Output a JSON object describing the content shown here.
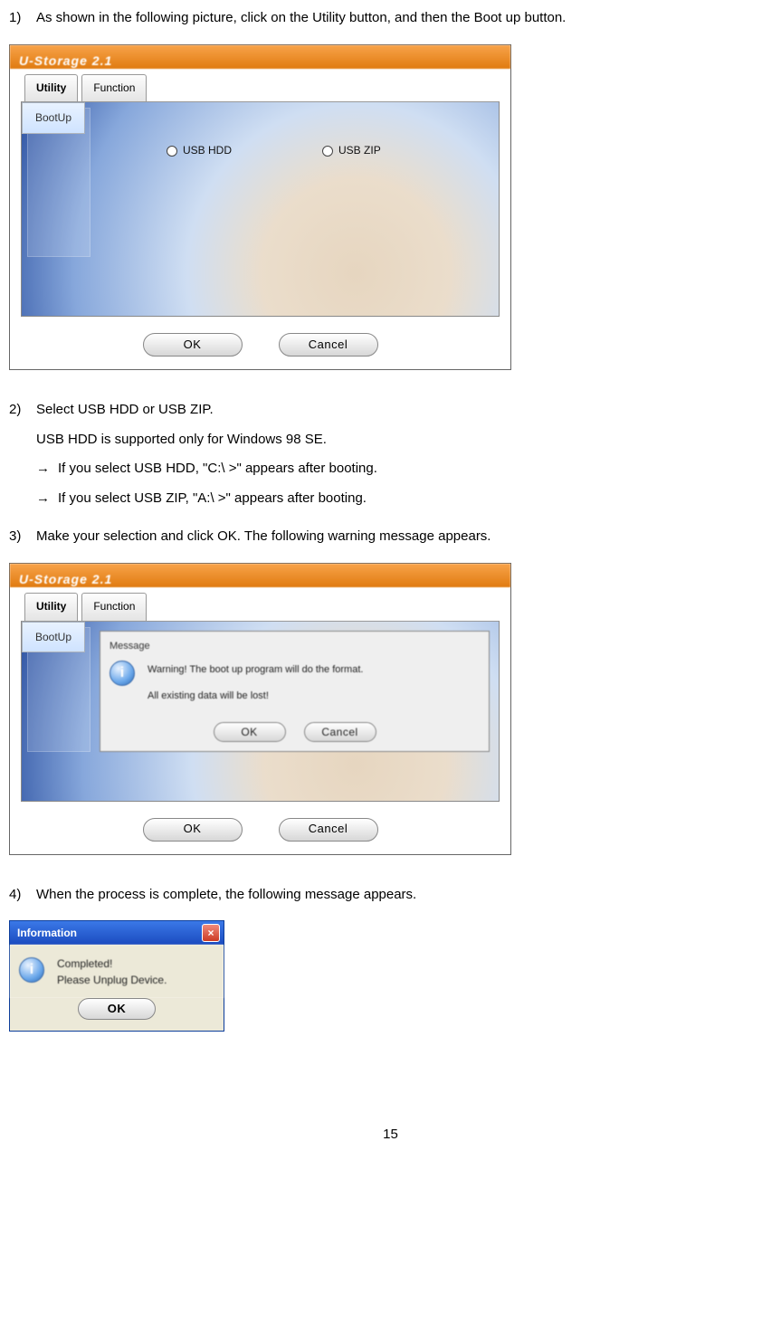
{
  "step1": {
    "num": "1)",
    "text": "As shown in the following picture, click on the Utility button, and then the Boot up button."
  },
  "app": {
    "title": "U-Storage 2.1",
    "tab_utility": "Utility",
    "tab_function": "Function",
    "side_bootup": "BootUp",
    "radio_hdd": "USB HDD",
    "radio_zip": "USB ZIP",
    "btn_ok": "OK",
    "btn_cancel": "Cancel"
  },
  "step2": {
    "num": "2)",
    "line1": "Select USB HDD or USB ZIP.",
    "line2": "USB HDD is supported only for Windows 98 SE.",
    "arrow": "→",
    "sub1": "If you select USB HDD, \"C:\\ >\" appears after booting.",
    "sub2": "If you select USB ZIP, \"A:\\ >\" appears after booting."
  },
  "step3": {
    "num": "3)",
    "text": "Make your selection and click OK. The following warning message appears.",
    "msg_title": "Message",
    "msg_l1": "Warning! The boot up program will do the format.",
    "msg_l2": "All existing data will be lost!",
    "msg_ok": "OK",
    "msg_cancel": "Cancel"
  },
  "step4": {
    "num": "4)",
    "text": "When the process is complete, the following message appears.",
    "info_title": "Information",
    "info_l1": "Completed!",
    "info_l2": "Please Unplug Device.",
    "info_ok": "OK"
  },
  "pagenum": "15"
}
